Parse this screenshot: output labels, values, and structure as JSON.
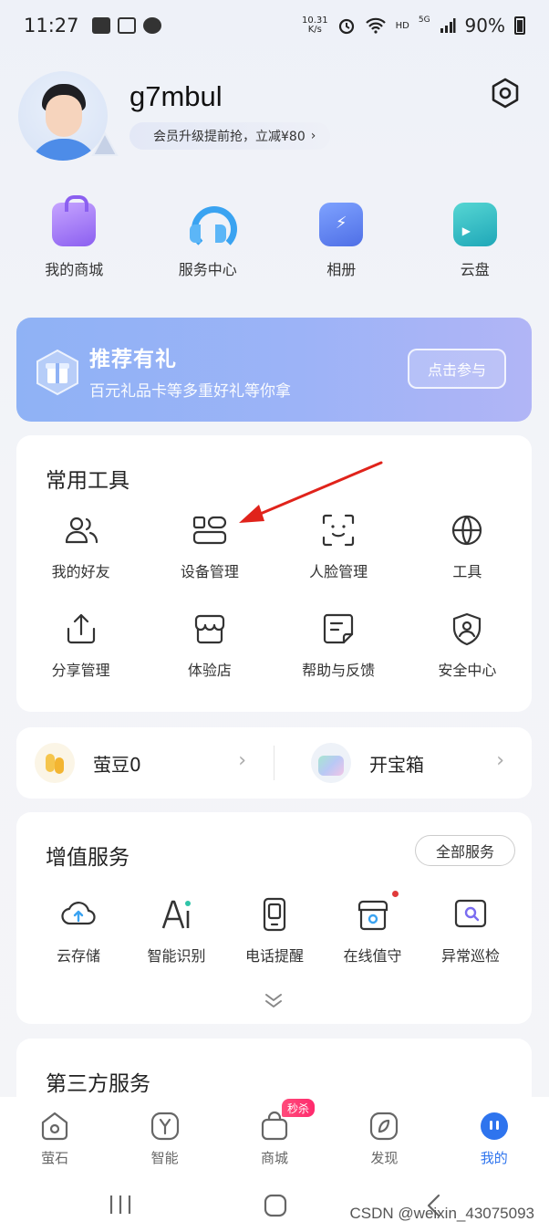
{
  "status_bar": {
    "time": "11:27",
    "net_speed_value": "10.31",
    "net_speed_unit": "K/s",
    "network_label": "HD",
    "signal_label": "5G",
    "battery": "90%"
  },
  "profile": {
    "username": "g7mbul",
    "member_promo": "会员升级提前抢，立减¥80",
    "member_chevron": "›"
  },
  "quick_links": [
    {
      "label": "我的商城",
      "icon": "shopping-bag-icon"
    },
    {
      "label": "服务中心",
      "icon": "headset-icon"
    },
    {
      "label": "相册",
      "icon": "album-icon"
    },
    {
      "label": "云盘",
      "icon": "cloud-drive-icon"
    }
  ],
  "banner": {
    "title": "推荐有礼",
    "subtitle": "百元礼品卡等多重好礼等你拿",
    "button": "点击参与"
  },
  "tools": {
    "title": "常用工具",
    "items": [
      {
        "label": "我的好友",
        "icon": "friends-icon"
      },
      {
        "label": "设备管理",
        "icon": "device-manage-icon"
      },
      {
        "label": "人脸管理",
        "icon": "face-scan-icon"
      },
      {
        "label": "工具",
        "icon": "globe-icon"
      },
      {
        "label": "分享管理",
        "icon": "share-icon"
      },
      {
        "label": "体验店",
        "icon": "store-icon"
      },
      {
        "label": "帮助与反馈",
        "icon": "feedback-icon"
      },
      {
        "label": "安全中心",
        "icon": "security-icon"
      }
    ]
  },
  "beans": {
    "left_label": "萤豆0",
    "right_label": "开宝箱",
    "chevron": "›"
  },
  "value_services": {
    "title": "增值服务",
    "all_button": "全部服务",
    "items": [
      {
        "label": "云存储",
        "icon": "cloud-upload-icon"
      },
      {
        "label": "智能识别",
        "icon": "ai-icon"
      },
      {
        "label": "电话提醒",
        "icon": "phone-icon"
      },
      {
        "label": "在线值守",
        "icon": "camera-store-icon"
      },
      {
        "label": "异常巡检",
        "icon": "inspection-icon"
      }
    ]
  },
  "third_party": {
    "title": "第三方服务"
  },
  "bottom_nav": [
    {
      "label": "萤石",
      "icon": "home-icon"
    },
    {
      "label": "智能",
      "icon": "smart-icon"
    },
    {
      "label": "商城",
      "icon": "mall-icon",
      "badge": "秒杀"
    },
    {
      "label": "发现",
      "icon": "discover-icon"
    },
    {
      "label": "我的",
      "icon": "profile-icon",
      "active": true
    }
  ],
  "watermark": "CSDN @weixin_43075093",
  "colors": {
    "accent": "#2e74ee",
    "banner": "#9cb3f7",
    "arrow": "#e0231b"
  }
}
